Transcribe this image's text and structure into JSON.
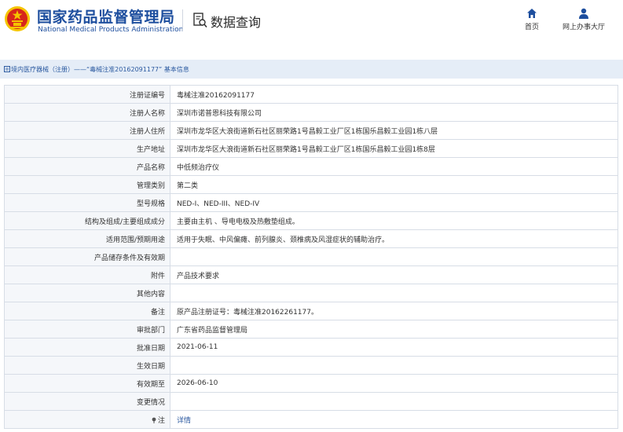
{
  "header": {
    "brand_cn": "国家药品监督管理局",
    "brand_en": "National Medical Products Administration",
    "section_title": "数据查询",
    "nav": [
      {
        "label": "首页",
        "icon": "home-icon"
      },
      {
        "label": "网上办事大厅",
        "icon": "user-icon"
      }
    ]
  },
  "breadcrumb": {
    "text": "境内医疗器械（注册）——“毒械注准20162091177” 基本信息"
  },
  "colors": {
    "brand_blue": "#1d4e9e",
    "emblem_red": "#d7261b",
    "emblem_gold": "#f5c400",
    "crumb_bg": "#e5edf7",
    "link": "#2c5aa0"
  },
  "details": {
    "rows": [
      {
        "key": "注册证编号",
        "value": "毒械注准20162091177"
      },
      {
        "key": "注册人名称",
        "value": "深圳市诺普恩科技有限公司"
      },
      {
        "key": "注册人住所",
        "value": "深圳市龙华区大浪街道新石社区丽荣路1号昌毅工业厂区1栋国乐昌毅工业园1栋八层"
      },
      {
        "key": "生产地址",
        "value": "深圳市龙华区大浪街道新石社区丽荣路1号昌毅工业厂区1栋国乐昌毅工业园1栋8层"
      },
      {
        "key": "产品名称",
        "value": "中低频治疗仪"
      },
      {
        "key": "管理类别",
        "value": "第二类"
      },
      {
        "key": "型号规格",
        "value": "NED-I、NED-III、NED-IV"
      },
      {
        "key": "结构及组成/主要组成成分",
        "value": "主要由主机 、导电电极及热敷垫组成。"
      },
      {
        "key": "适用范围/预期用途",
        "value": "适用于失眠、中风偏瘫、前列腺炎、颈椎病及风湿症状的辅助治疗。"
      },
      {
        "key": "产品储存条件及有效期",
        "value": ""
      },
      {
        "key": "附件",
        "value": "产品技术要求"
      },
      {
        "key": "其他内容",
        "value": ""
      },
      {
        "key": "备注",
        "value": "原产品注册证号：毒械注准20162261177。"
      },
      {
        "key": "审批部门",
        "value": "广东省药品监督管理局"
      },
      {
        "key": "批准日期",
        "value": "2021-06-11"
      },
      {
        "key": "生效日期",
        "value": ""
      },
      {
        "key": "有效期至",
        "value": "2026-06-10"
      },
      {
        "key": "变更情况",
        "value": ""
      },
      {
        "key": "注",
        "value": "详情",
        "link": true,
        "key_icon": "pin-icon"
      }
    ]
  }
}
